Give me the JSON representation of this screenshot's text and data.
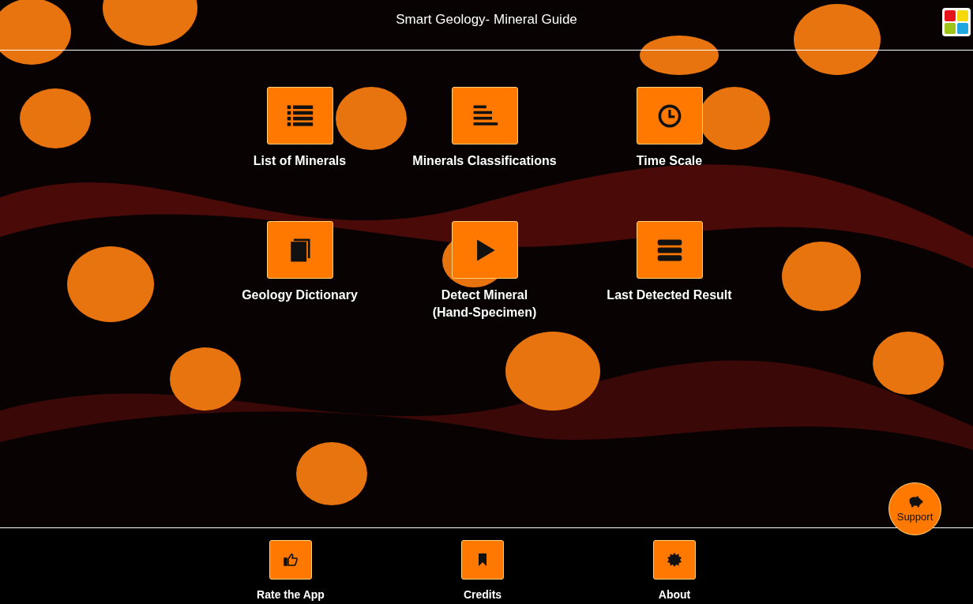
{
  "header": {
    "title": "Smart Geology- Mineral Guide"
  },
  "tiles": [
    {
      "label": "List of Minerals"
    },
    {
      "label": "Minerals Classifications"
    },
    {
      "label": "Time Scale"
    },
    {
      "label": "Geology Dictionary"
    },
    {
      "label": "Detect Mineral (Hand-Specimen)"
    },
    {
      "label": "Last Detected Result"
    }
  ],
  "support": {
    "label": "Support"
  },
  "footer": [
    {
      "label": "Rate the App"
    },
    {
      "label": "Credits"
    },
    {
      "label": "About"
    }
  ]
}
